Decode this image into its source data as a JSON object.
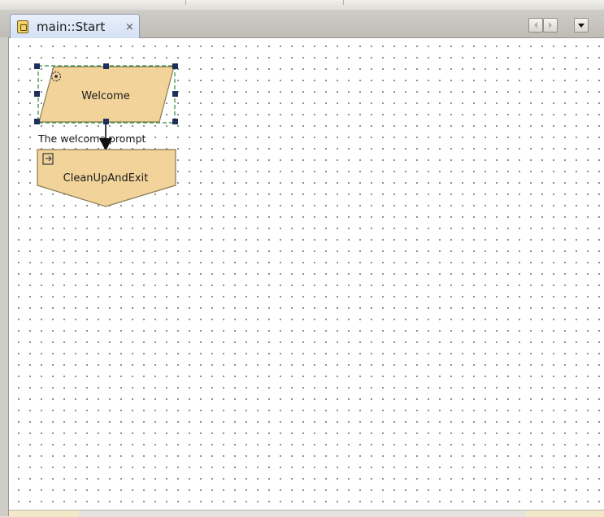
{
  "tab": {
    "title": "main::Start",
    "close_glyph": "×",
    "icon": "flow-document-icon"
  },
  "nav": {
    "prev_glyph": "◂",
    "next_glyph": "▸",
    "menu_glyph": "▾"
  },
  "diagram": {
    "nodes": [
      {
        "label": "Welcome",
        "shape": "parallelogram",
        "icon": "gear-icon",
        "selected": true
      },
      {
        "label": "CleanUpAndExit",
        "shape": "pentagon",
        "icon": "exit-icon",
        "selected": false
      }
    ],
    "edge_label": "The welcome prompt"
  },
  "colors": {
    "node_fill": "#f2d49a",
    "node_stroke": "#8a7b52",
    "selection_handle": "#1f2f5c",
    "selection_dash": "#2e8b3a",
    "grid_dot": "#7d7d7d"
  }
}
